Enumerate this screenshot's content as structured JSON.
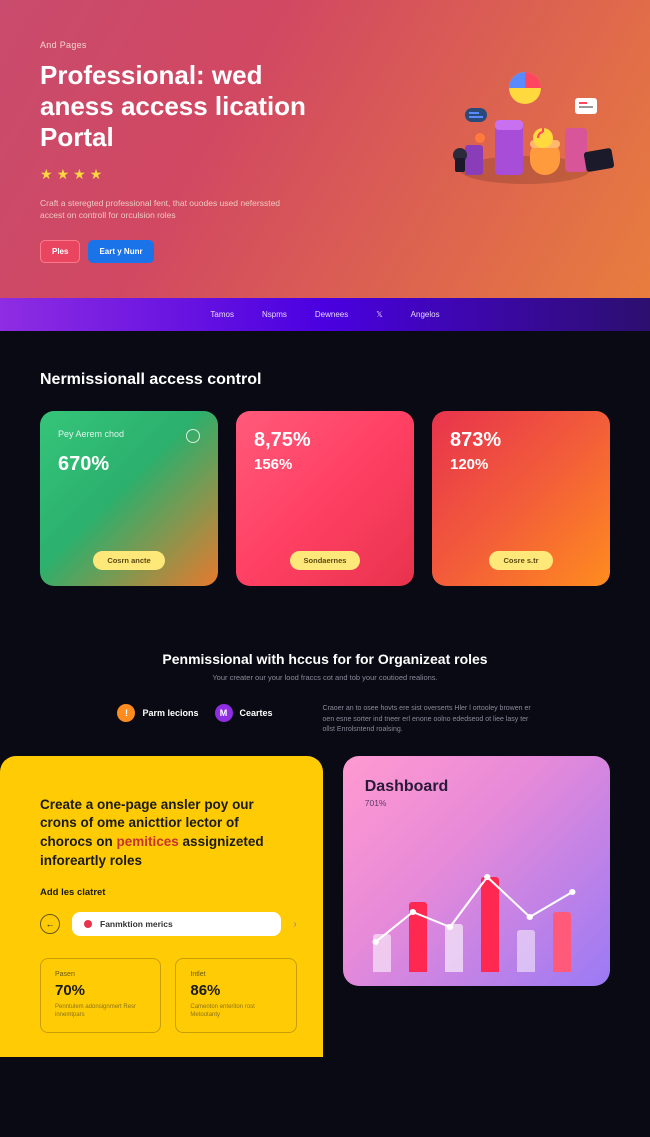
{
  "hero": {
    "breadcrumb": "And Pages",
    "title": "Professional: wed aness access lication Portal",
    "subtitle": "Craft a steregted professional fent, that ouodes used neferssted accest on controll for orculsion roles",
    "btn_primary": "Ples",
    "btn_secondary": "Eart y Nunr"
  },
  "nav": {
    "items": [
      "Tamos",
      "Nspms",
      "Dewnees",
      "𝕏",
      "Angelos"
    ]
  },
  "access": {
    "title": "Nermissionall access control",
    "cards": [
      {
        "label": "Pey Aerem chod",
        "big": "670%",
        "small": "",
        "btn": "Cosrn ancte"
      },
      {
        "label": "",
        "big": "8,75%",
        "small": "156%",
        "btn": "Sondaernes"
      },
      {
        "label": "",
        "big": "873%",
        "small": "120%",
        "btn": "Cosre s.tr"
      }
    ]
  },
  "mid": {
    "title": "Penmissional with hccus for for Organizeat roles",
    "subtitle": "Your creater our your lood fraccs cot and tob your coutioed realions.",
    "tabs": [
      {
        "icon": "!",
        "label": "Parm lecions"
      },
      {
        "icon": "M",
        "label": "Ceartes"
      }
    ],
    "desc": "Craoer an to osee hovts ere sist overserts Hler l ortooley browen er oen esne sorter ind tneer erl enone oolno ededseod ot liee lasy ter ollst Enrolsntend roalsing."
  },
  "yellow": {
    "heading_line1": "Create a one-page ansler poy our crons of ome anicttior lector of chorocs on ",
    "heading_hl1": "pemitices",
    "heading_mid": " assignizeted inforeartly ",
    "heading_hl2": "roles",
    "sub": "Add les clatret",
    "arrow": "←",
    "tag": "Fanmktion merics",
    "stats": [
      {
        "label": "Pasen",
        "val": "70%",
        "desc": "Penntulem adonsignmert Resr innemtpars"
      },
      {
        "label": "Intlet",
        "val": "86%",
        "desc": "Camenton enteriton rost Metootanty"
      }
    ]
  },
  "dashboard": {
    "title": "Dashboard",
    "subtitle": "701%"
  }
}
